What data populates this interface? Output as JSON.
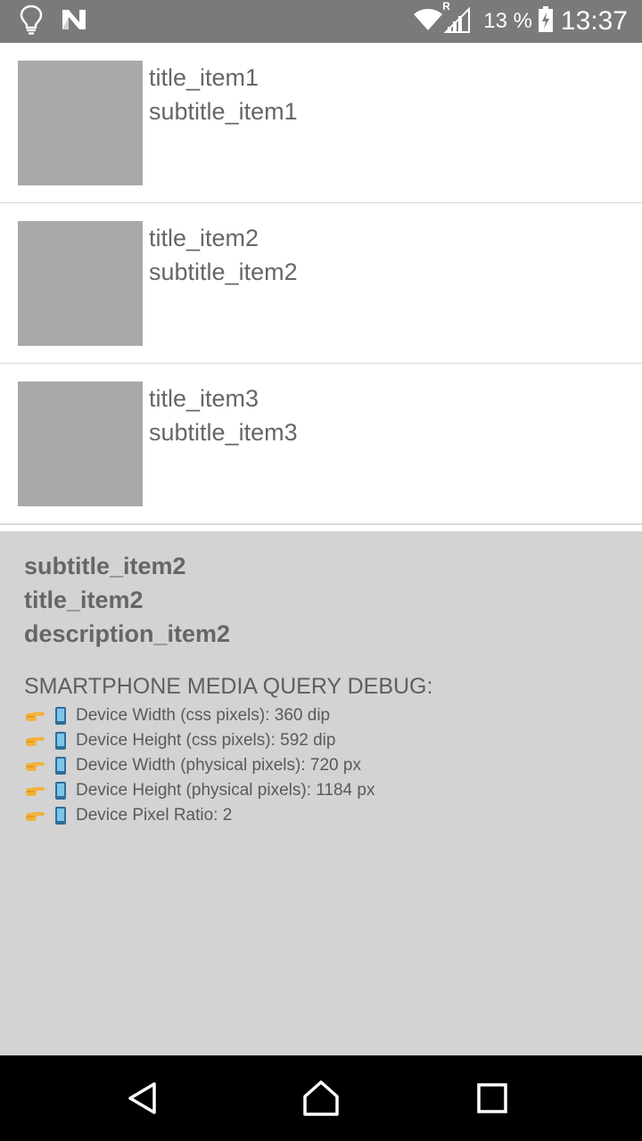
{
  "status_bar": {
    "battery_percent": "13 %",
    "time": "13:37",
    "network_roaming": "R",
    "icons": [
      "lightbulb-icon",
      "n-logo-icon",
      "wifi-icon",
      "signal-icon",
      "battery-charging-icon"
    ]
  },
  "list": {
    "items": [
      {
        "title": "title_item1",
        "subtitle": "subtitle_item1"
      },
      {
        "title": "title_item2",
        "subtitle": "subtitle_item2"
      },
      {
        "title": "title_item3",
        "subtitle": "subtitle_item3"
      }
    ]
  },
  "detail": {
    "subtitle": "subtitle_item2",
    "title": "title_item2",
    "description": "description_item2"
  },
  "debug": {
    "heading": "SMARTPHONE MEDIA QUERY DEBUG:",
    "rows": [
      "Device Width (css pixels): 360 dip",
      "Device Height (css pixels): 592 dip",
      "Device Width (physical pixels): 720 px",
      "Device Height (physical pixels): 1184 px",
      "Device Pixel Ratio: 2"
    ],
    "row_icons": [
      "pointing-hand-icon",
      "mobile-phone-icon"
    ]
  },
  "nav_bar": {
    "buttons": [
      "back-icon",
      "home-icon",
      "recents-icon"
    ]
  },
  "colors": {
    "status_bar_bg": "#7a7a7a",
    "thumbnail": "#a9a9a9",
    "detail_bg": "#d3d3d3",
    "text": "#666666",
    "nav_bar_bg": "#000000"
  }
}
